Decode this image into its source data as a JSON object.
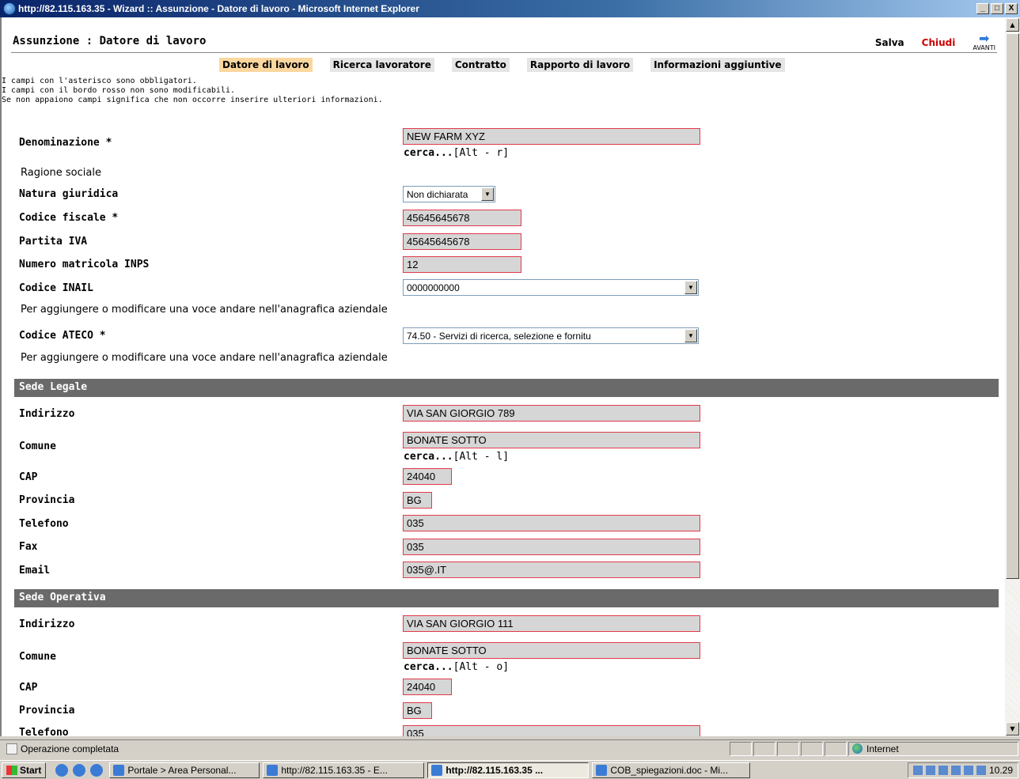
{
  "window": {
    "title": "http://82.115.163.35 - Wizard :: Assunzione - Datore di lavoro - Microsoft Internet Explorer",
    "btn_min": "_",
    "btn_max": "□",
    "btn_close": "X"
  },
  "header": {
    "title": "Assunzione : Datore di lavoro",
    "save_label": "Salva",
    "close_label": "Chiudi",
    "next_label": "AVANTI",
    "next_arrow": "➡"
  },
  "tabs": [
    {
      "label": "Datore di lavoro",
      "active": true
    },
    {
      "label": "Ricerca lavoratore",
      "active": false
    },
    {
      "label": "Contratto",
      "active": false
    },
    {
      "label": "Rapporto di lavoro",
      "active": false
    },
    {
      "label": "Informazioni aggiuntive",
      "active": false
    }
  ],
  "notes": [
    "I campi con l'asterisco sono obbligatori.",
    "I campi con il bordo rosso non sono modificabili.",
    "Se non appaiono campi significa che non occorre inserire ulteriori informazioni."
  ],
  "datore": {
    "denominazione": {
      "label": "Denominazione *",
      "value": "NEW FARM XYZ",
      "cerca": "cerca...",
      "shortcut": "[Alt - r]"
    },
    "ragione_sociale": "Ragione sociale",
    "natura": {
      "label": "Natura giuridica",
      "value": "Non dichiarata"
    },
    "codice_fiscale": {
      "label": "Codice fiscale *",
      "value": "45645645678"
    },
    "partita_iva": {
      "label": "Partita IVA",
      "value": "45645645678"
    },
    "matricola_inps": {
      "label": "Numero matricola INPS",
      "value": "12"
    },
    "codice_inail": {
      "label": "Codice INAIL",
      "value": "0000000000"
    },
    "hint1": "Per aggiungere o modificare una voce andare nell'anagrafica aziendale",
    "codice_ateco": {
      "label": "Codice ATECO *",
      "value": "74.50 - Servizi di ricerca, selezione e fornitu"
    },
    "hint2": "Per aggiungere o modificare una voce andare nell'anagrafica aziendale"
  },
  "sede_legale": {
    "title": "Sede Legale",
    "indirizzo": {
      "label": "Indirizzo",
      "value": "VIA SAN GIORGIO 789"
    },
    "comune": {
      "label": "Comune",
      "value": "BONATE SOTTO",
      "cerca": "cerca...",
      "shortcut": "[Alt - l]"
    },
    "cap": {
      "label": "CAP",
      "value": "24040"
    },
    "provincia": {
      "label": "Provincia",
      "value": "BG"
    },
    "telefono": {
      "label": "Telefono",
      "value": "035"
    },
    "fax": {
      "label": "Fax",
      "value": "035"
    },
    "email": {
      "label": "Email",
      "value": "035@.IT"
    }
  },
  "sede_operativa": {
    "title": "Sede Operativa",
    "indirizzo": {
      "label": "Indirizzo",
      "value": "VIA SAN GIORGIO 111"
    },
    "comune": {
      "label": "Comune",
      "value": "BONATE SOTTO",
      "cerca": "cerca...",
      "shortcut": "[Alt - o]"
    },
    "cap": {
      "label": "CAP",
      "value": "24040"
    },
    "provincia": {
      "label": "Provincia",
      "value": "BG"
    },
    "telefono": {
      "label": "Telefono",
      "value": "035"
    }
  },
  "statusbar": {
    "text": "Operazione completata",
    "zone": "Internet"
  },
  "taskbar": {
    "start": "Start",
    "tasks": [
      {
        "label": "Portale > Area Personal...",
        "active": false
      },
      {
        "label": "http://82.115.163.35 - E...",
        "active": false
      },
      {
        "label": "http://82.115.163.35 ...",
        "active": true
      },
      {
        "label": "COB_spiegazioni.doc - Mi...",
        "active": false
      }
    ],
    "clock": "10.29"
  }
}
